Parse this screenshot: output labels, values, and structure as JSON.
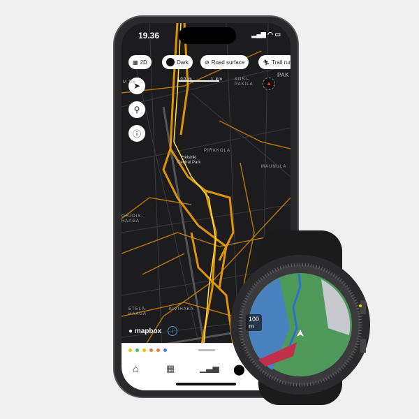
{
  "status": {
    "time": "19.36"
  },
  "chips": [
    {
      "icon": "map-icon",
      "label": "2D"
    },
    {
      "icon": "dark-mode-icon",
      "label": "Dark"
    },
    {
      "icon": "eye-off-icon",
      "label": "Road surface"
    },
    {
      "icon": "runner-icon",
      "label": "Trail run"
    }
  ],
  "map": {
    "scale": {
      "short": "100 m",
      "long": "1 km"
    },
    "labels": {
      "pakila": "ANSI-\nPAKILA",
      "pak": "PAK",
      "pirkkola": "PIRKKOLA",
      "park": "Helsinki\nCentral Park",
      "maunula": "MAUNULA",
      "pohjois": "OHJOIS-\nHAAGA",
      "etela": "ETELÄ-\nHAAGA",
      "kivihaka": "KIVIHAKA",
      "me": "M    NE"
    },
    "attribution": "mapbox",
    "heat_color": "#f5a300"
  },
  "sheet": {
    "dots": [
      "#f2c200",
      "#3cc060",
      "#f2c200",
      "#f07a30",
      "#f07a30",
      "#4a7fe0"
    ]
  },
  "watch": {
    "scale": "100 m"
  }
}
